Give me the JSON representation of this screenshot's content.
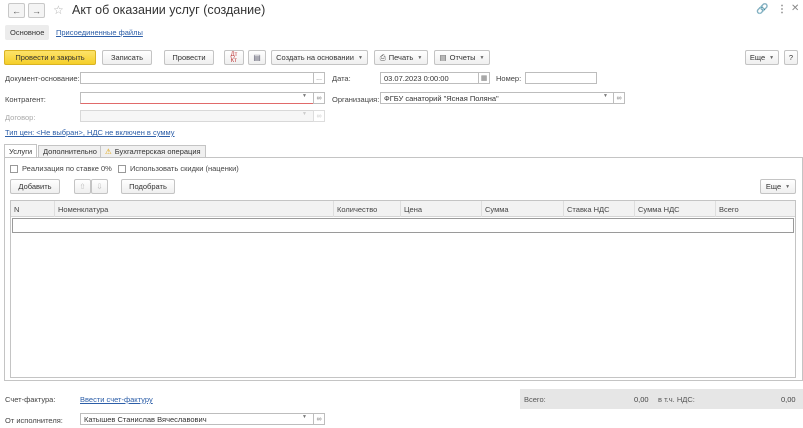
{
  "header": {
    "title": "Акт об оказании услуг (создание)",
    "back_icon": "arrow-left-icon",
    "forward_icon": "arrow-right-icon",
    "link_icon": "link-icon",
    "more_icon": "kebab-icon",
    "close_icon": "close-icon"
  },
  "view_tabs": {
    "main": "Основное",
    "files": "Присоединенные файлы"
  },
  "toolbar": {
    "post_close": "Провести и закрыть",
    "save": "Записать",
    "post": "Провести",
    "create_based": "Создать на основании",
    "print": "Печать",
    "reports": "Отчеты",
    "more": "Еще"
  },
  "form": {
    "base_doc_label": "Документ-основание:",
    "base_doc_value": "",
    "date_label": "Дата:",
    "date_value": "03.07.2023  0:00:00",
    "number_label": "Номер:",
    "number_value": "",
    "counterparty_label": "Контрагент:",
    "counterparty_value": "",
    "org_label": "Организация:",
    "org_value": "ФГБУ санаторий \"Ясная Поляна\"",
    "contract_label": "Договор:",
    "contract_value": "",
    "price_type_link": "Тип цен: <Не выбран>, НДС не включен в сумму"
  },
  "subtabs": {
    "services": "Услуги",
    "extra": "Дополнительно",
    "accounting": "Бухгалтерская операция"
  },
  "options": {
    "zero_rate": "Реализация по ставке 0%",
    "use_discounts": "Использовать скидки (наценки)"
  },
  "table_toolbar": {
    "add": "Добавить",
    "pick": "Подобрать",
    "more": "Еще"
  },
  "table": {
    "columns": [
      "N",
      "Номенклатура",
      "Количество",
      "Цена",
      "Сумма",
      "Ставка НДС",
      "Сумма НДС",
      "Всего"
    ]
  },
  "footer": {
    "invoice_label": "Счет-фактура:",
    "invoice_link": "Ввести счет-фактуру",
    "executor_label": "От исполнителя:",
    "executor_value": "Катышев Станислав Вячеславович",
    "total_label": "Всего:",
    "total_value": "0,00",
    "vat_label": "в т.ч. НДС:",
    "vat_value": "0,00"
  }
}
